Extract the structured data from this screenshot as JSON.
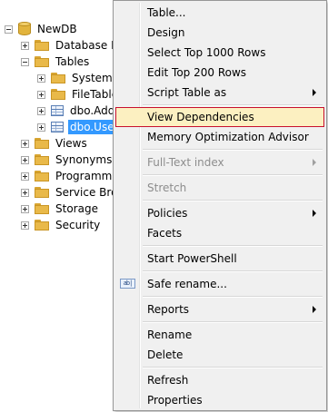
{
  "tree": {
    "database": "NewDB",
    "items": [
      {
        "label": "Database Dia"
      },
      {
        "label": "Tables"
      },
      {
        "label": "System T"
      },
      {
        "label": "FileTable"
      },
      {
        "label": "dbo.Add"
      },
      {
        "label": "dbo.User"
      },
      {
        "label": "Views"
      },
      {
        "label": "Synonyms"
      },
      {
        "label": "Programmat"
      },
      {
        "label": "Service Broke"
      },
      {
        "label": "Storage"
      },
      {
        "label": "Security"
      }
    ]
  },
  "menu": {
    "items": [
      {
        "label": "Table..."
      },
      {
        "label": "Design"
      },
      {
        "label": "Select Top 1000 Rows"
      },
      {
        "label": "Edit Top 200 Rows"
      },
      {
        "label": "Script Table as"
      },
      {
        "label": "View Dependencies"
      },
      {
        "label": "Memory Optimization Advisor"
      },
      {
        "label": "Full-Text index"
      },
      {
        "label": "Stretch"
      },
      {
        "label": "Policies"
      },
      {
        "label": "Facets"
      },
      {
        "label": "Start PowerShell"
      },
      {
        "label": "Safe rename..."
      },
      {
        "label": "Reports"
      },
      {
        "label": "Rename"
      },
      {
        "label": "Delete"
      },
      {
        "label": "Refresh"
      },
      {
        "label": "Properties"
      }
    ],
    "rename_icon_text": "ab|"
  },
  "colors": {
    "selection": "#3399ff",
    "highlight_fill": "#fcf0c1",
    "highlight_border": "#c8102e",
    "menu_background": "#f0f0f0",
    "disabled_text": "#8d8d8d"
  }
}
